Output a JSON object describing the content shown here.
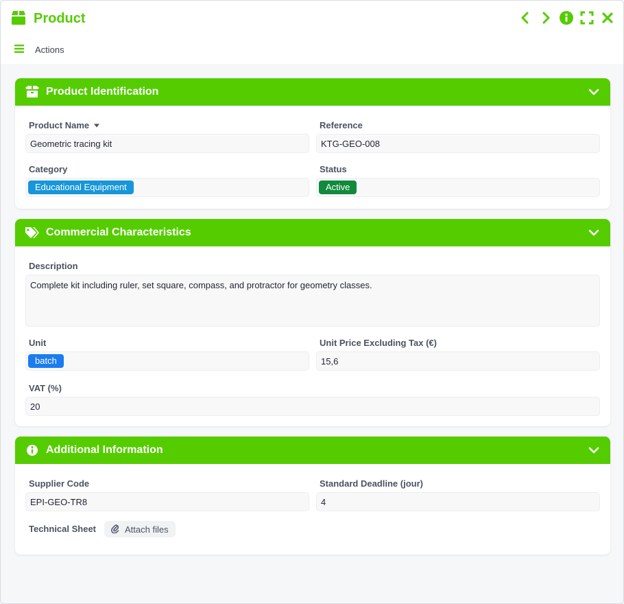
{
  "window": {
    "title": "Product",
    "actions_label": "Actions"
  },
  "colors": {
    "accent": "#55cc00",
    "category_tag": "#1796d9",
    "status_tag": "#118a3b",
    "unit_tag": "#1a7cf0"
  },
  "sections": {
    "identification": {
      "title": "Product Identification",
      "product_name_label": "Product Name",
      "product_name_value": "Geometric tracing kit",
      "reference_label": "Reference",
      "reference_value": "KTG-GEO-008",
      "category_label": "Category",
      "category_value": "Educational Equipment",
      "status_label": "Status",
      "status_value": "Active"
    },
    "commercial": {
      "title": "Commercial Characteristics",
      "description_label": "Description",
      "description_value": "Complete kit including ruler, set square, compass, and protractor for geometry classes.",
      "unit_label": "Unit",
      "unit_value": "batch",
      "price_label": "Unit Price Excluding Tax (€)",
      "price_value": "15,6",
      "vat_label": "VAT (%)",
      "vat_value": "20"
    },
    "additional": {
      "title": "Additional Information",
      "supplier_label": "Supplier Code",
      "supplier_value": "EPI-GEO-TR8",
      "deadline_label": "Standard Deadline (jour)",
      "deadline_value": "4",
      "sheet_label": "Technical Sheet",
      "attach_label": "Attach files"
    }
  }
}
